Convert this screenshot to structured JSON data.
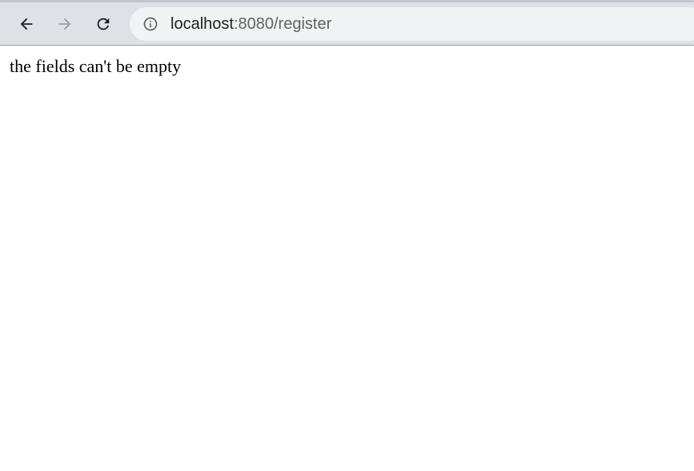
{
  "browser": {
    "back_icon": "arrow-left-icon",
    "forward_icon": "arrow-right-icon",
    "reload_icon": "reload-icon",
    "info_icon": "info-circle-icon",
    "address": {
      "host": "localhost",
      "path": ":8080/register"
    },
    "colors": {
      "toolbar": "#dee1e6",
      "omnibox": "#f1f3f4",
      "icon_active": "#202124",
      "icon_disabled": "#9aa0a6"
    }
  },
  "page": {
    "message": "the fields can't be empty"
  }
}
